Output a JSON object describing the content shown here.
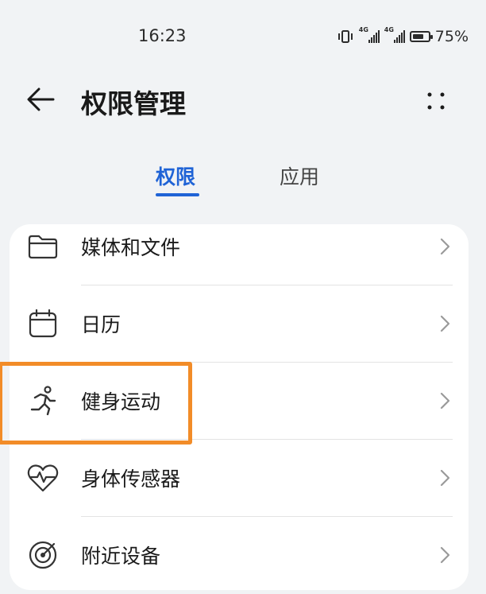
{
  "status_bar": {
    "time": "16:23",
    "battery": "75%",
    "battery_level": 0.75,
    "signal_tag": "4G"
  },
  "header": {
    "title": "权限管理"
  },
  "tabs": [
    {
      "label": "权限"
    },
    {
      "label": "应用"
    }
  ],
  "permissions": [
    {
      "label": "媒体和文件",
      "icon": "folder-icon"
    },
    {
      "label": "日历",
      "icon": "calendar-icon"
    },
    {
      "label": "健身运动",
      "icon": "running-icon"
    },
    {
      "label": "身体传感器",
      "icon": "heart-pulse-icon"
    },
    {
      "label": "附近设备",
      "icon": "nearby-device-icon"
    }
  ],
  "colors": {
    "accent": "#1f63d6",
    "highlight": "#f28c28",
    "background": "#f1f3f5"
  }
}
